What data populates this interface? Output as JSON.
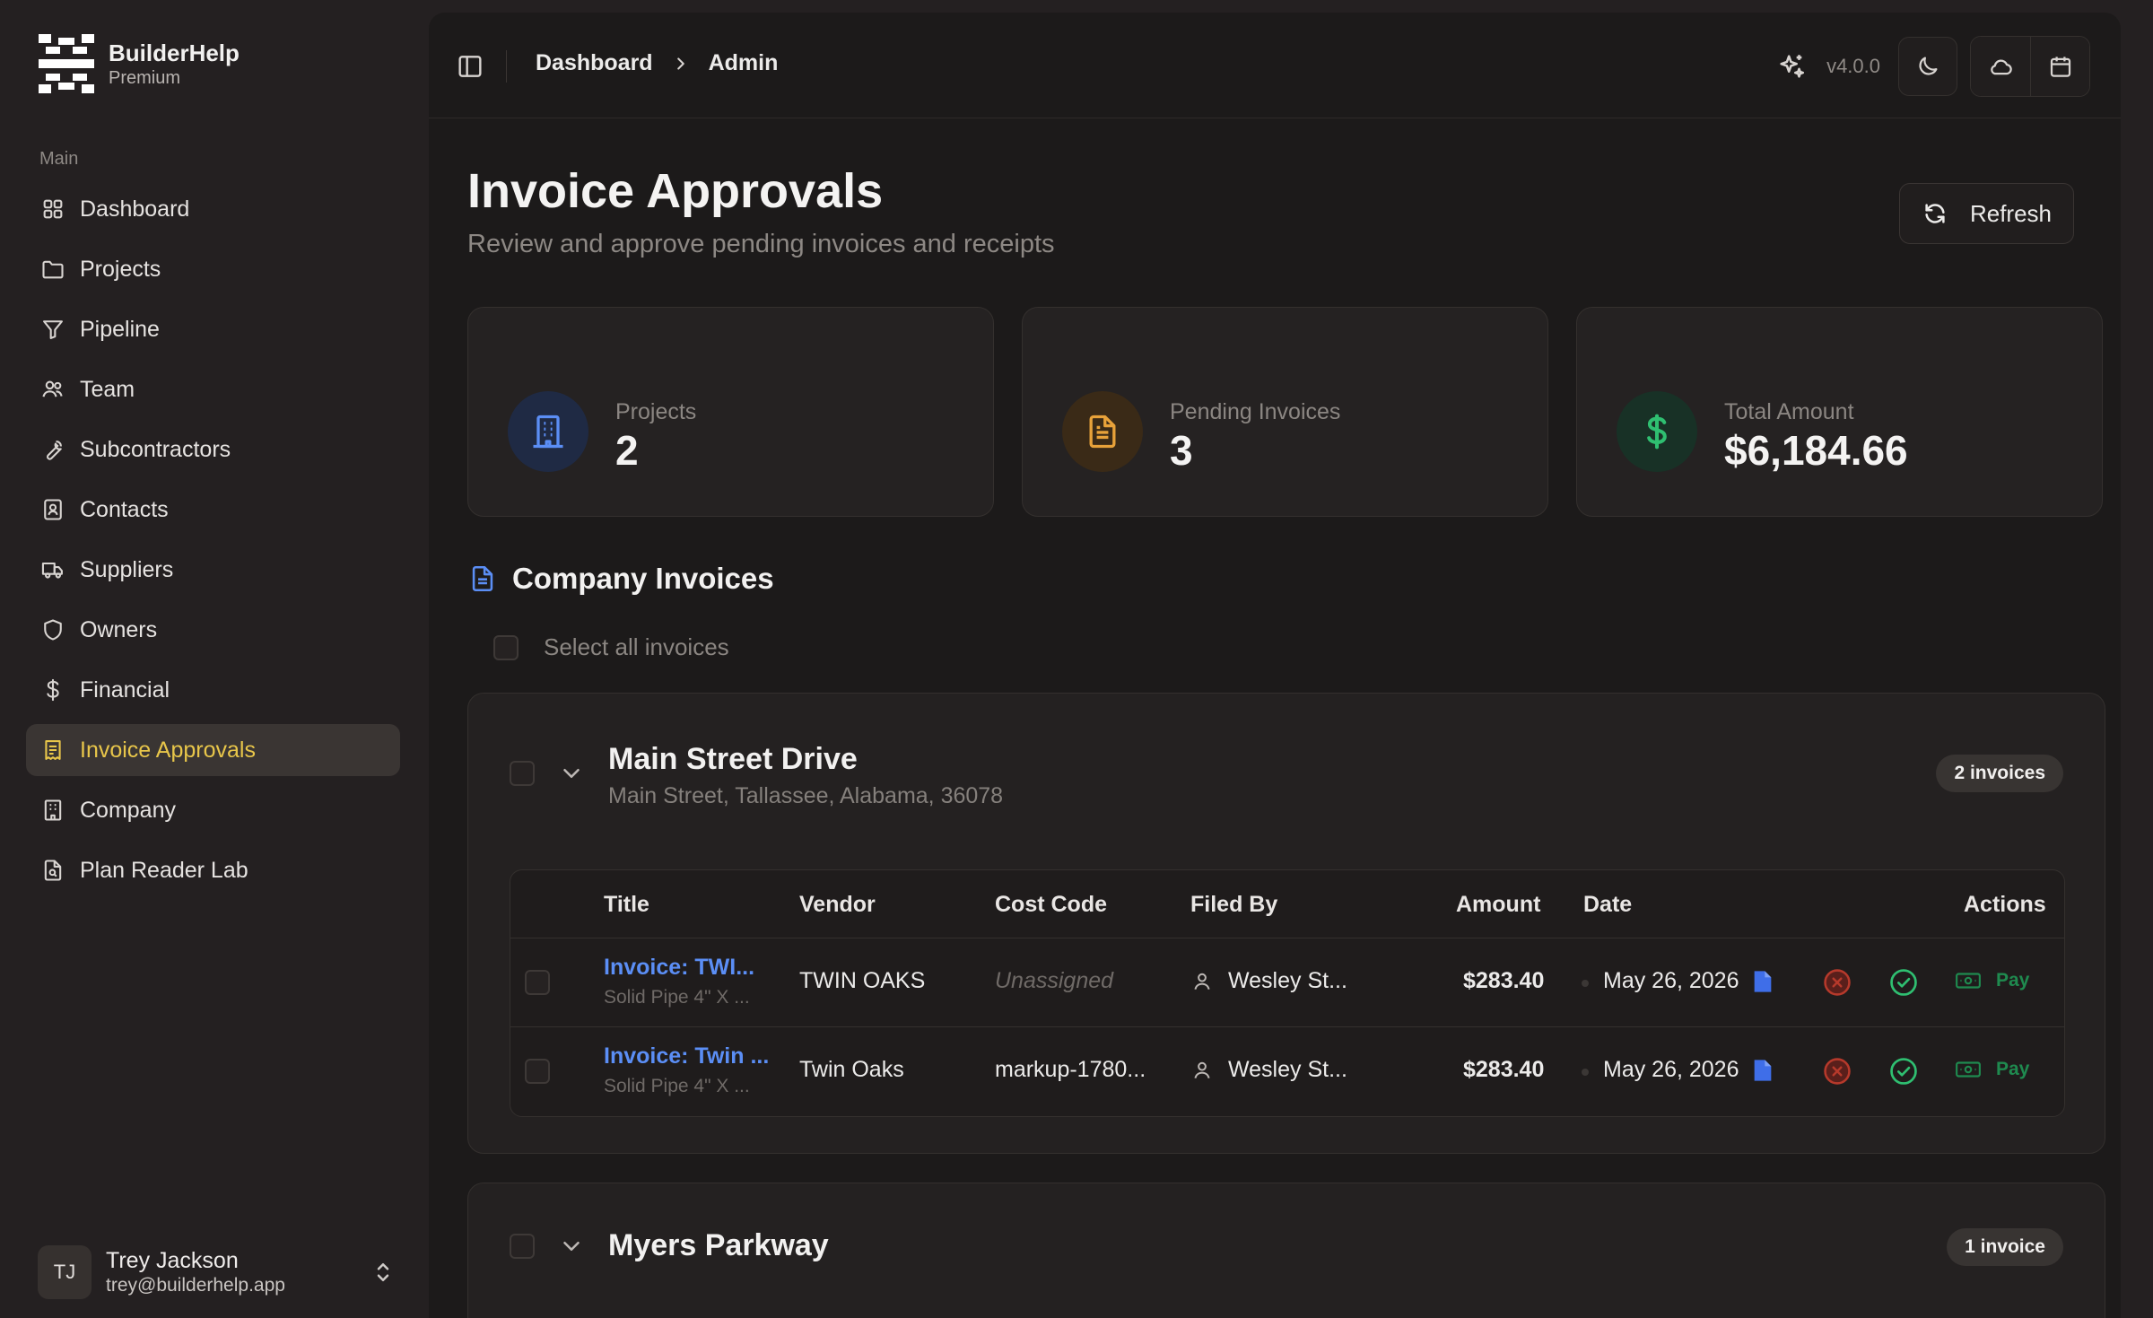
{
  "brand": {
    "name": "BuilderHelp",
    "tier": "Premium"
  },
  "sidebar": {
    "section_label": "Main",
    "items": [
      {
        "label": "Dashboard",
        "icon": "grid-icon"
      },
      {
        "label": "Projects",
        "icon": "folder-icon"
      },
      {
        "label": "Pipeline",
        "icon": "filter-icon"
      },
      {
        "label": "Team",
        "icon": "users-icon"
      },
      {
        "label": "Subcontractors",
        "icon": "wrench-icon"
      },
      {
        "label": "Contacts",
        "icon": "contact-book-icon"
      },
      {
        "label": "Suppliers",
        "icon": "truck-icon"
      },
      {
        "label": "Owners",
        "icon": "shield-icon"
      },
      {
        "label": "Financial",
        "icon": "dollar-icon"
      },
      {
        "label": "Invoice Approvals",
        "icon": "receipt-icon",
        "active": true
      },
      {
        "label": "Company",
        "icon": "building-icon"
      },
      {
        "label": "Plan Reader Lab",
        "icon": "file-search-icon"
      }
    ]
  },
  "user": {
    "initials": "TJ",
    "name": "Trey Jackson",
    "email": "trey@builderhelp.app"
  },
  "topbar": {
    "breadcrumbs": [
      "Dashboard",
      "Admin"
    ],
    "version": "v4.0.0"
  },
  "page": {
    "title": "Invoice Approvals",
    "subtitle": "Review and approve pending invoices and receipts",
    "refresh_label": "Refresh"
  },
  "stats": [
    {
      "label": "Projects",
      "value": "2",
      "icon": "building-icon",
      "color": "#5b8ef5"
    },
    {
      "label": "Pending Invoices",
      "value": "3",
      "icon": "document-icon",
      "color": "#e8a23a"
    },
    {
      "label": "Total Amount",
      "value": "$6,184.66",
      "icon": "dollar-icon",
      "color": "#2fbf71"
    }
  ],
  "invoices_section": {
    "title": "Company Invoices",
    "select_all_label": "Select all invoices"
  },
  "table_headers": [
    "Title",
    "Vendor",
    "Cost Code",
    "Filed By",
    "Amount",
    "Date",
    "Actions"
  ],
  "projects": [
    {
      "name": "Main Street Drive",
      "address": "Main Street, Tallassee, Alabama, 36078",
      "badge": "2 invoices",
      "invoices": [
        {
          "title": "Invoice: TWI...",
          "desc": "Solid Pipe 4\" X ...",
          "vendor": "TWIN OAKS",
          "cost_code": "Unassigned",
          "filed_by": "Wesley St...",
          "amount": "$283.40",
          "date": "May 26, 2026",
          "pay_label": "Pay"
        },
        {
          "title": "Invoice: Twin ...",
          "desc": "Solid Pipe 4\" X ...",
          "vendor": "Twin Oaks",
          "cost_code": "markup-1780...",
          "filed_by": "Wesley St...",
          "amount": "$283.40",
          "date": "May 26, 2026",
          "pay_label": "Pay"
        }
      ]
    },
    {
      "name": "Myers Parkway",
      "badge": "1 invoice"
    }
  ],
  "colors": {
    "accent_active": "#e8c64a",
    "link": "#5b8ef5",
    "reject": "#c0392b",
    "approve": "#2fbf71",
    "pay": "#1f8a4f"
  }
}
